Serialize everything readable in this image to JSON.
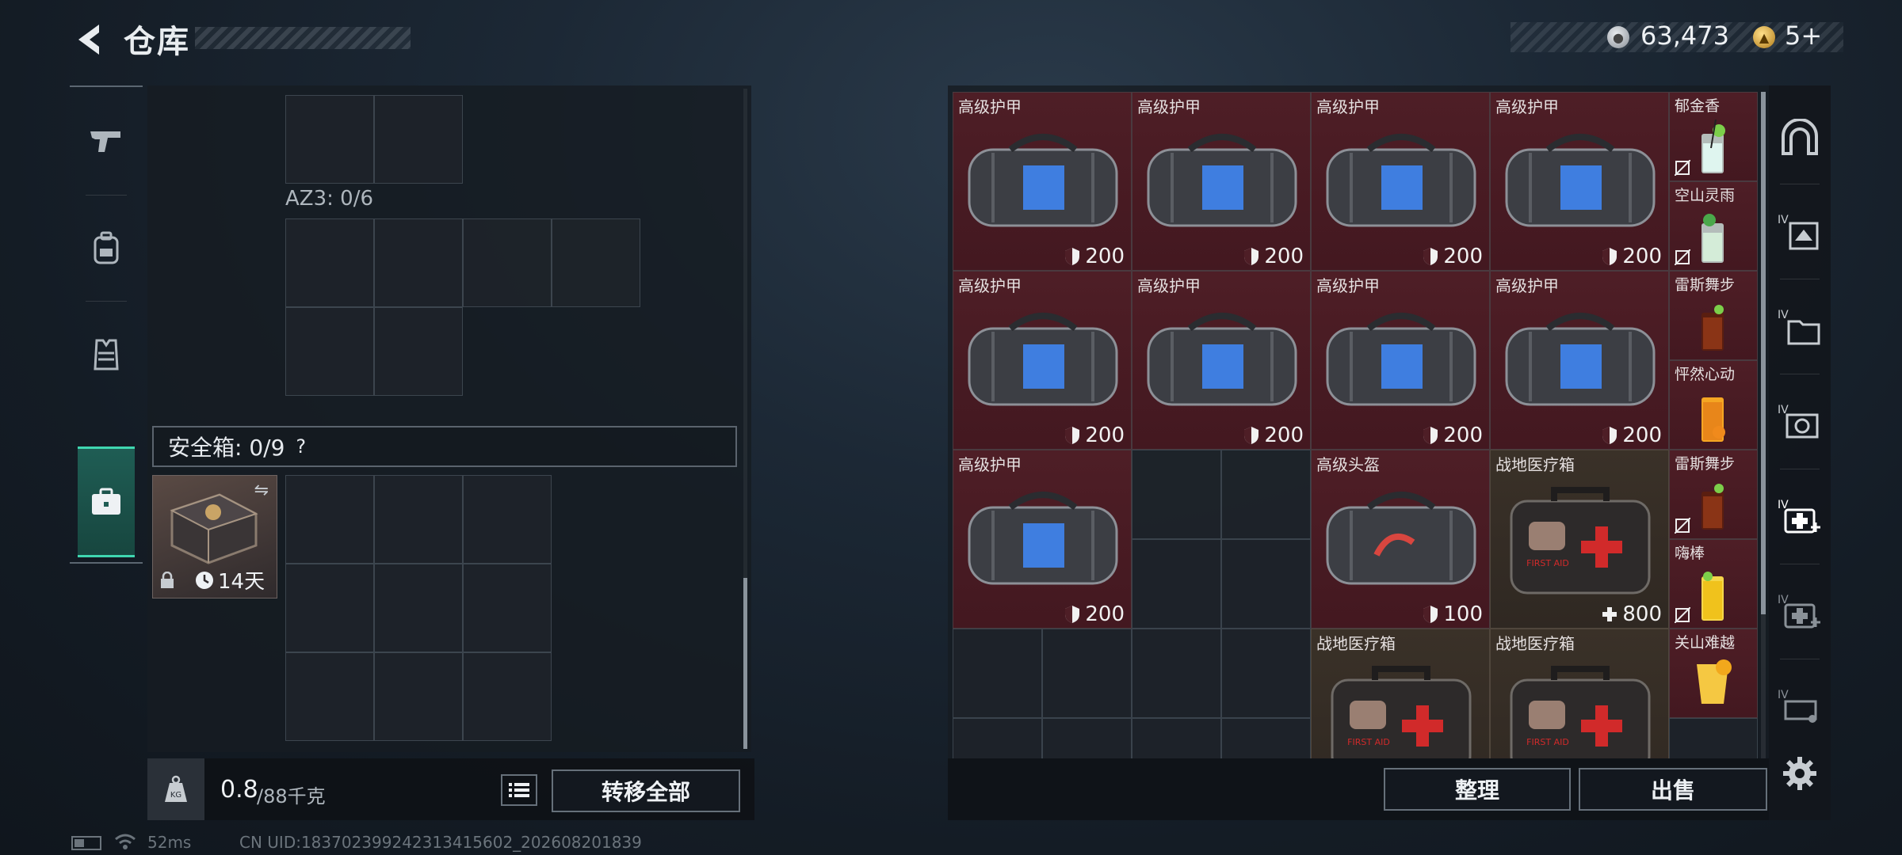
{
  "header": {
    "title": "仓库"
  },
  "currency": {
    "coins": "63,473",
    "tickets": "5+"
  },
  "left": {
    "az3_label": "AZ3: 0/6",
    "safebox_label": "安全箱: 0/9",
    "help_glyph": "?",
    "safebox_duration": "14天",
    "weight_value": "0.8",
    "weight_max": "/88千克",
    "kg_label": "KG",
    "transfer_all": "转移全部"
  },
  "right": {
    "sort": "整理",
    "sell": "出售"
  },
  "items": {
    "armor_name": "高级护甲",
    "armor_value": "200",
    "helmet_name": "高级头盔",
    "helmet_value": "100",
    "medkit_name": "战地医疗箱",
    "medkit_value": "800",
    "medkit_text": "FIRST AID",
    "drinks": [
      "郁金香",
      "空山灵雨",
      "雷斯舞步",
      "怦然心动",
      "雷斯舞步",
      "嗨棒",
      "关山难越"
    ]
  },
  "status": {
    "ping": "52ms",
    "uid": "CN UID:183702399242313415602_202608201839"
  },
  "colors": {
    "accent": "#3fd6b0",
    "item_red": "#4e1e26",
    "item_gold": "#3a3128"
  }
}
